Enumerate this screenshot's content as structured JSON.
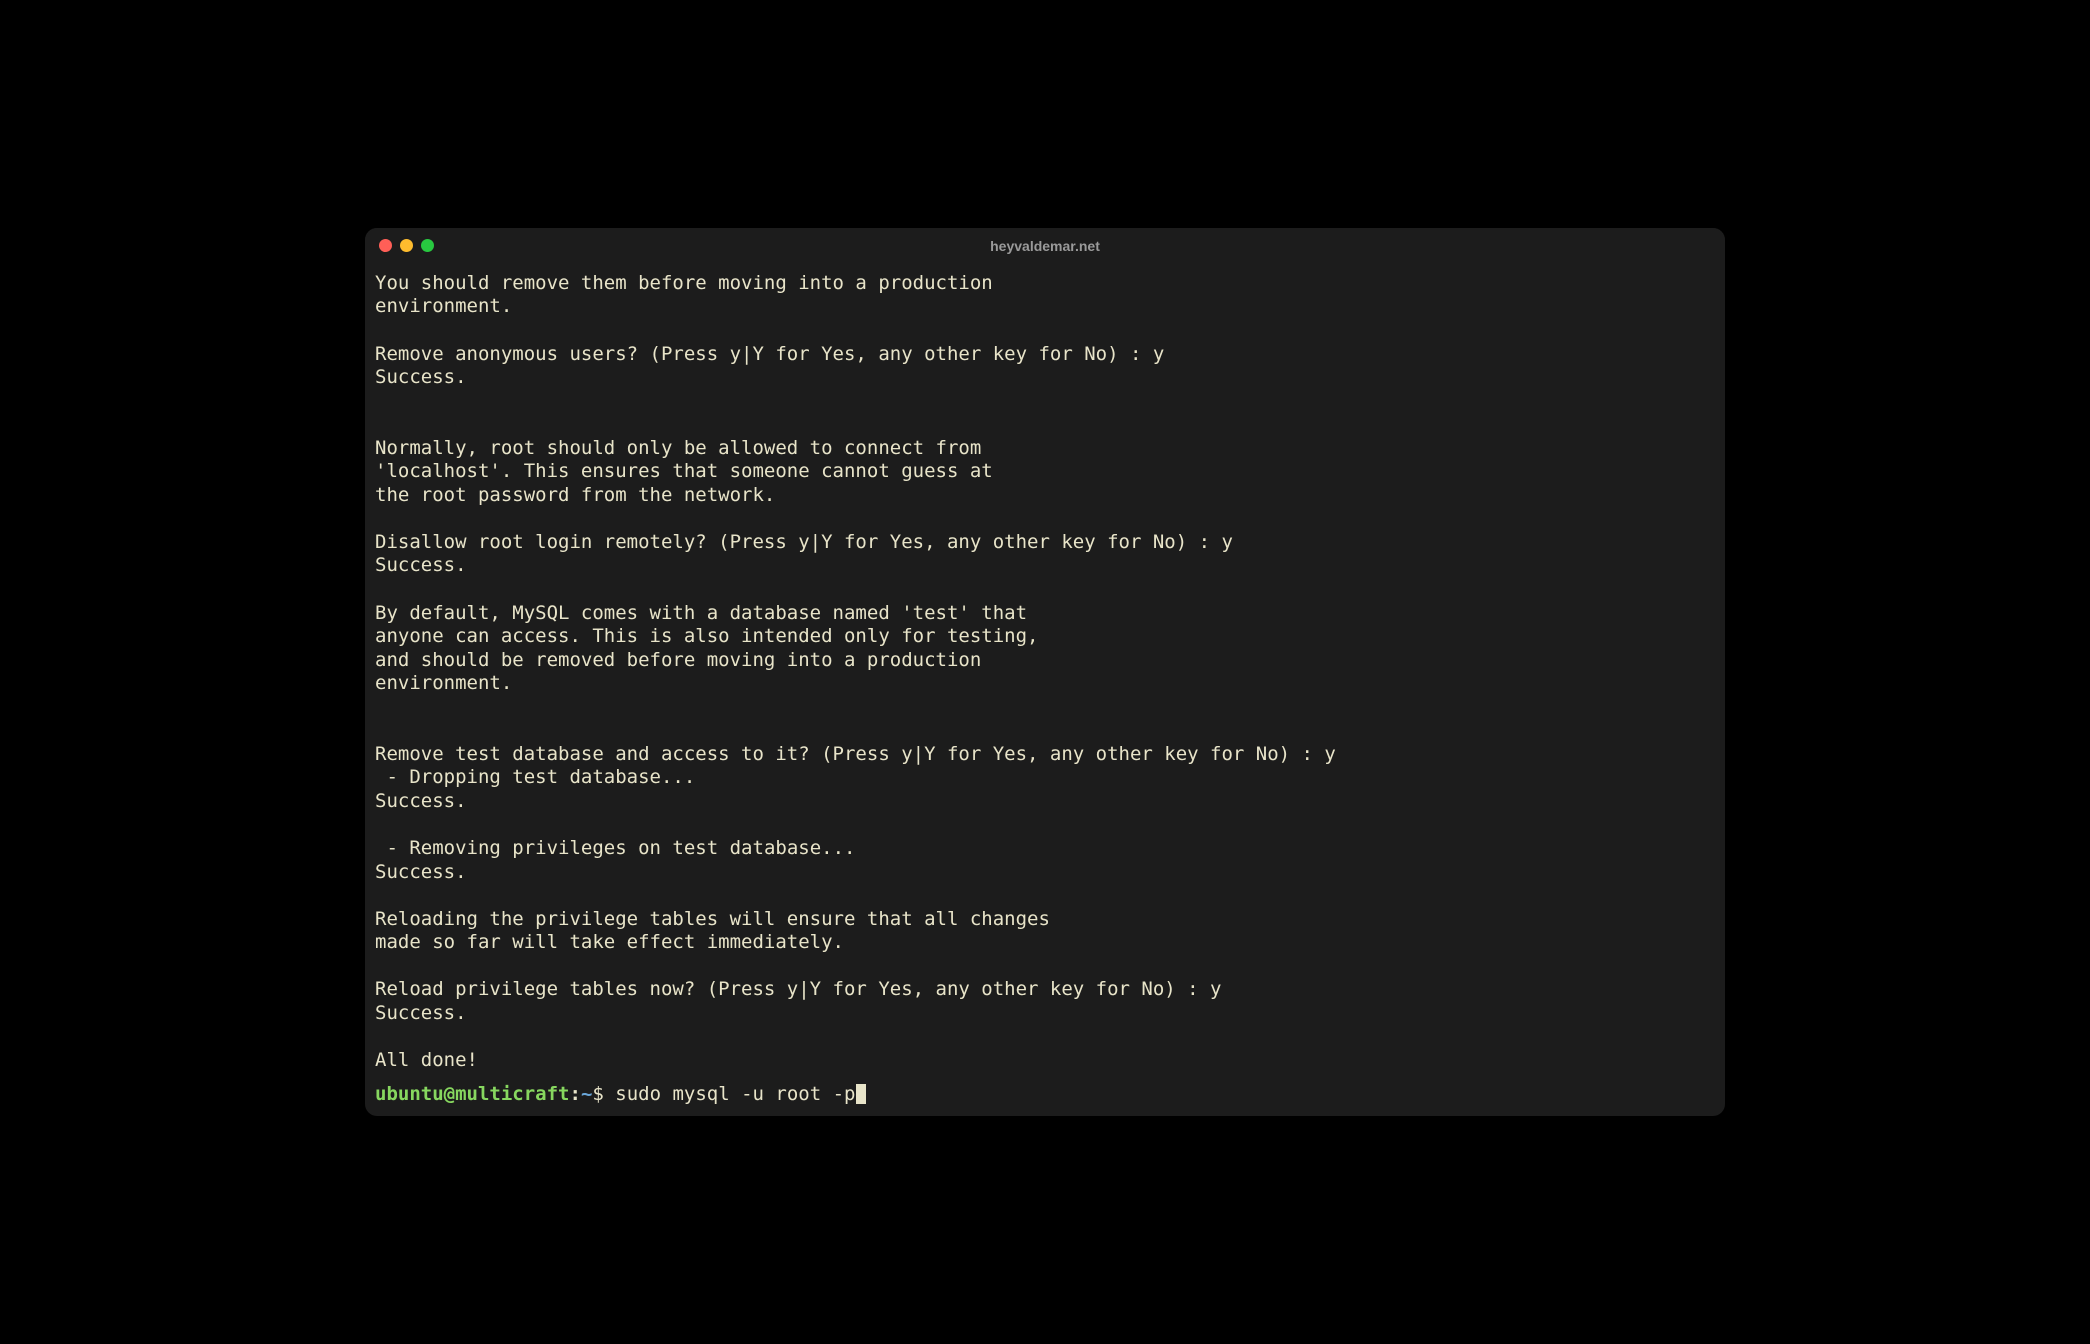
{
  "titlebar": {
    "title": "heyvaldemar.net"
  },
  "terminal": {
    "output": "You should remove them before moving into a production\nenvironment.\n\nRemove anonymous users? (Press y|Y for Yes, any other key for No) : y\nSuccess.\n\n\nNormally, root should only be allowed to connect from\n'localhost'. This ensures that someone cannot guess at\nthe root password from the network.\n\nDisallow root login remotely? (Press y|Y for Yes, any other key for No) : y\nSuccess.\n\nBy default, MySQL comes with a database named 'test' that\nanyone can access. This is also intended only for testing,\nand should be removed before moving into a production\nenvironment.\n\n\nRemove test database and access to it? (Press y|Y for Yes, any other key for No) : y\n - Dropping test database...\nSuccess.\n\n - Removing privileges on test database...\nSuccess.\n\nReloading the privilege tables will ensure that all changes\nmade so far will take effect immediately.\n\nReload privilege tables now? (Press y|Y for Yes, any other key for No) : y\nSuccess.\n\nAll done!"
  },
  "prompt": {
    "user": "ubuntu",
    "at": "@",
    "host": "multicraft",
    "colon": ":",
    "path": "~",
    "dollar": "$ ",
    "command": "sudo mysql -u root -p"
  }
}
